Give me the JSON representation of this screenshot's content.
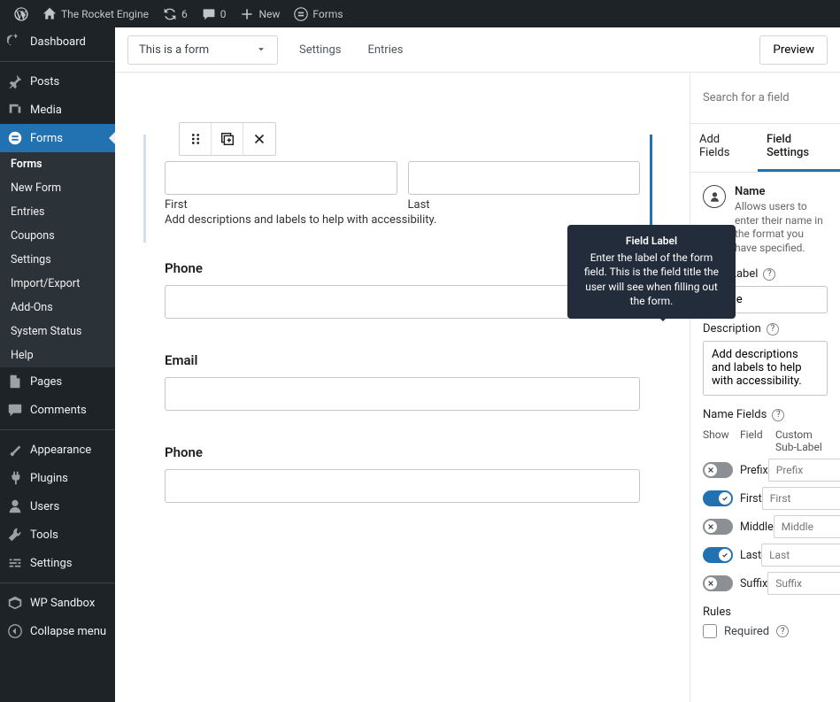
{
  "adminbar": {
    "site": "The Rocket Engine",
    "updates": "6",
    "comments": "0",
    "new": "New",
    "forms": "Forms"
  },
  "sidebar": {
    "dashboard": "Dashboard",
    "posts": "Posts",
    "media": "Media",
    "forms": "Forms",
    "submenu": {
      "forms": "Forms",
      "new_form": "New Form",
      "entries": "Entries",
      "coupons": "Coupons",
      "settings": "Settings",
      "import_export": "Import/Export",
      "addons": "Add-Ons",
      "system_status": "System Status",
      "help": "Help"
    },
    "pages": "Pages",
    "comments": "Comments",
    "appearance": "Appearance",
    "plugins": "Plugins",
    "users": "Users",
    "tools": "Tools",
    "settings": "Settings",
    "wp_sandbox": "WP Sandbox",
    "collapse": "Collapse menu"
  },
  "topbar": {
    "form_name": "This is a form",
    "settings": "Settings",
    "entries": "Entries",
    "preview": "Preview"
  },
  "canvas": {
    "name_field": {
      "first": "First",
      "last": "Last",
      "help": "Add descriptions and labels to help with accessibility."
    },
    "phone_label": "Phone",
    "email_label": "Email",
    "phone2_label": "Phone"
  },
  "panel": {
    "search_placeholder": "Search for a field",
    "tab_add": "Add Fields",
    "tab_settings": "Field Settings",
    "fieldtype": {
      "name": "Name",
      "desc": "Allows users to enter their name in the format you have specified."
    },
    "field_label": "Field Label",
    "field_label_value": "Name",
    "description": "Description",
    "description_value": "Add descriptions and labels to help with accessibility.",
    "name_fields": "Name Fields",
    "head_show": "Show",
    "head_field": "Field",
    "head_custom": "Custom Sub-Label",
    "rows": {
      "prefix": {
        "label": "Prefix",
        "placeholder": "Prefix",
        "on": false
      },
      "first": {
        "label": "First",
        "placeholder": "First",
        "on": true
      },
      "middle": {
        "label": "Middle",
        "placeholder": "Middle",
        "on": false
      },
      "last": {
        "label": "Last",
        "placeholder": "Last",
        "on": true
      },
      "suffix": {
        "label": "Suffix",
        "placeholder": "Suffix",
        "on": false
      }
    },
    "rules": "Rules",
    "required": "Required"
  },
  "tooltip": {
    "title": "Field Label",
    "body": "Enter the label of the form field. This is the field title the user will see when filling out the form."
  }
}
